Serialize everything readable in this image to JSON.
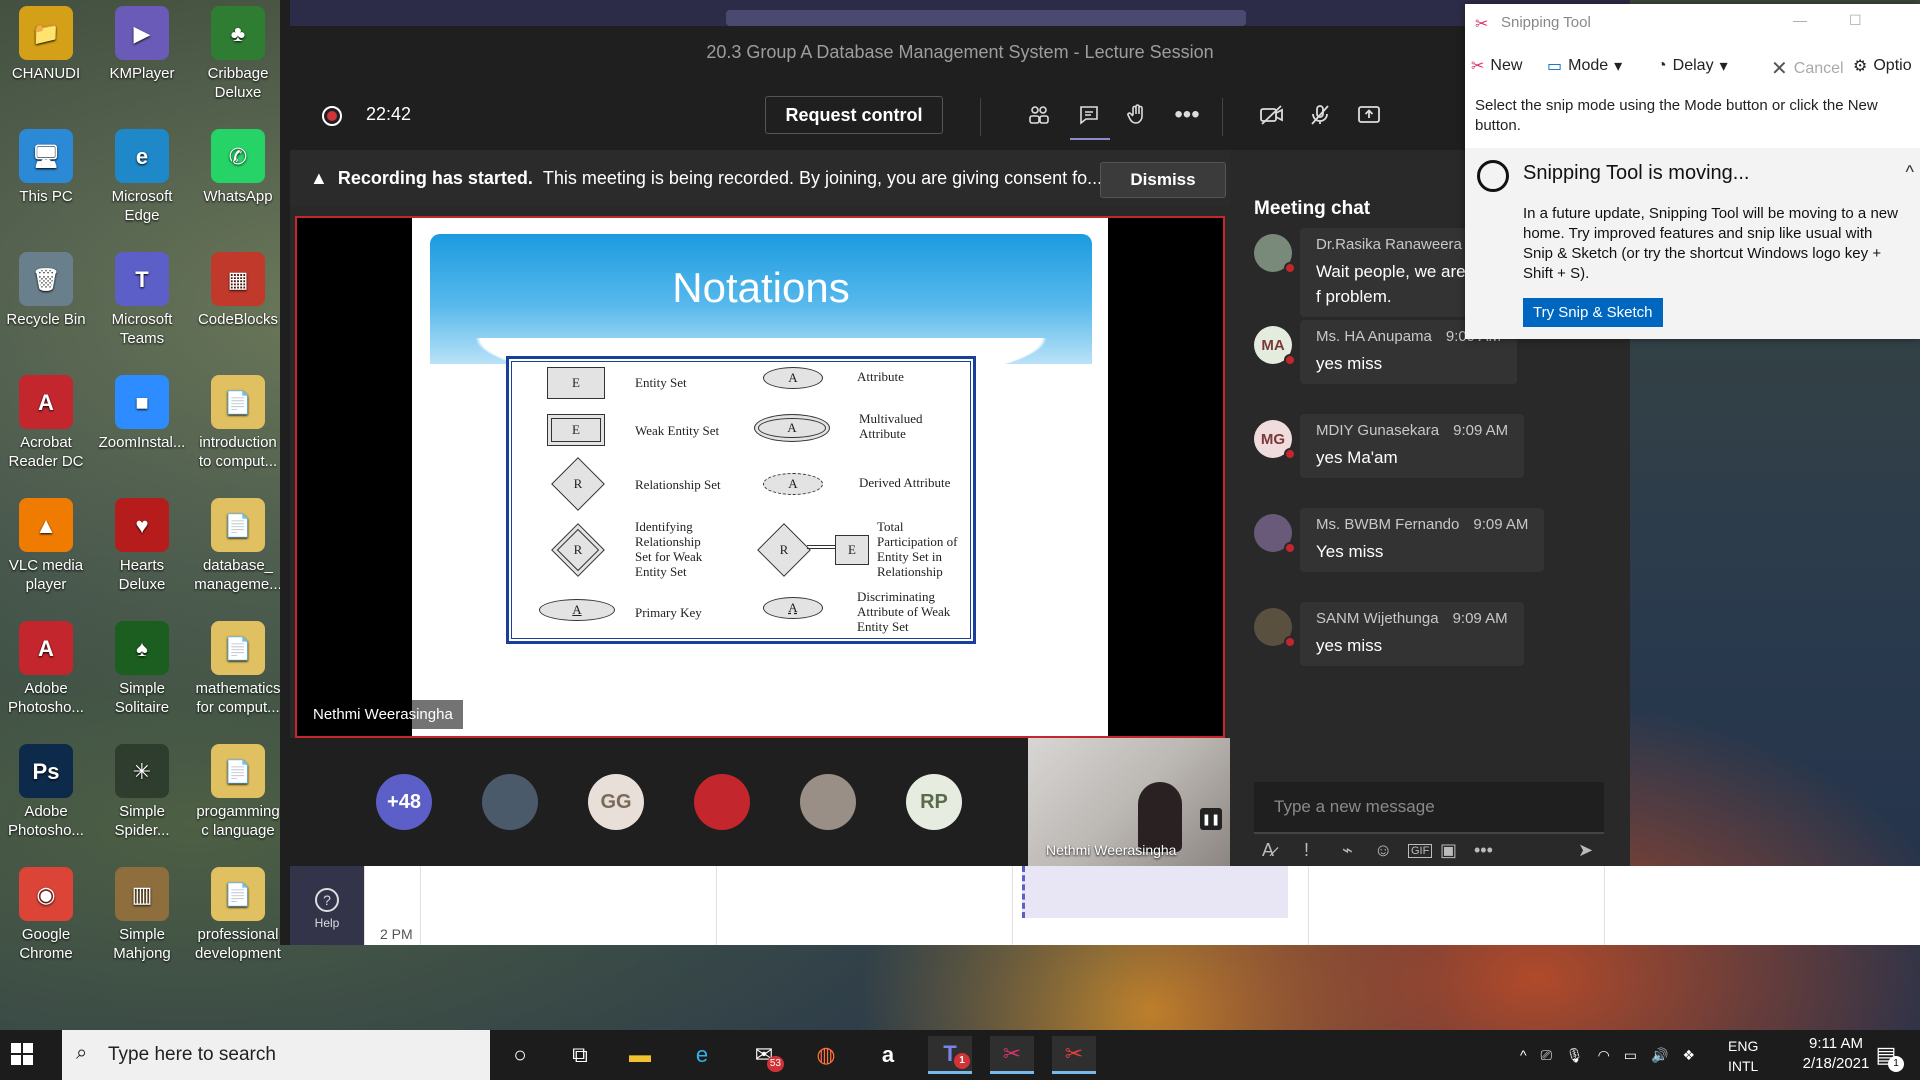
{
  "desktop": {
    "icons": [
      {
        "label": "CHANUDI",
        "glyph": "📁",
        "color": "#d4a017",
        "col": 0,
        "row": 0
      },
      {
        "label": "KMPlayer",
        "glyph": "▶",
        "color": "#6b5bb8",
        "col": 1,
        "row": 0
      },
      {
        "label": "Cribbage Deluxe",
        "glyph": "♣",
        "color": "#2e7d32",
        "col": 2,
        "row": 0
      },
      {
        "label": "This PC",
        "glyph": "🖥",
        "color": "#2b89d6",
        "col": 0,
        "row": 1
      },
      {
        "label": "Microsoft Edge",
        "glyph": "e",
        "color": "#1e88c8",
        "col": 1,
        "row": 1
      },
      {
        "label": "WhatsApp",
        "glyph": "✆",
        "color": "#25d366",
        "col": 2,
        "row": 1
      },
      {
        "label": "Recycle Bin",
        "glyph": "🗑",
        "color": "#6a7f8c",
        "col": 0,
        "row": 2
      },
      {
        "label": "Microsoft Teams",
        "glyph": "T",
        "color": "#5b5fc7",
        "col": 1,
        "row": 2
      },
      {
        "label": "CodeBlocks",
        "glyph": "▦",
        "color": "#c0392b",
        "col": 2,
        "row": 2
      },
      {
        "label": "Acrobat Reader DC",
        "glyph": "A",
        "color": "#c4262e",
        "col": 0,
        "row": 3
      },
      {
        "label": "ZoomInstal...",
        "glyph": "■",
        "color": "#2d8cff",
        "col": 1,
        "row": 3
      },
      {
        "label": "introduction to comput...",
        "glyph": "📄",
        "color": "#e0c060",
        "col": 2,
        "row": 3
      },
      {
        "label": "VLC media player",
        "glyph": "▲",
        "color": "#ef7c00",
        "col": 0,
        "row": 4
      },
      {
        "label": "Hearts Deluxe",
        "glyph": "♥",
        "color": "#b71c1c",
        "col": 1,
        "row": 4
      },
      {
        "label": "database_ manageme...",
        "glyph": "📄",
        "color": "#e0c060",
        "col": 2,
        "row": 4
      },
      {
        "label": "Adobe Photosho...",
        "glyph": "A",
        "color": "#c4262e",
        "col": 0,
        "row": 5
      },
      {
        "label": "Simple Solitaire",
        "glyph": "♠",
        "color": "#1b5e20",
        "col": 1,
        "row": 5
      },
      {
        "label": "mathematics for comput...",
        "glyph": "📄",
        "color": "#e0c060",
        "col": 2,
        "row": 5
      },
      {
        "label": "Adobe Photosho...",
        "glyph": "Ps",
        "color": "#0d2a4a",
        "col": 0,
        "row": 6
      },
      {
        "label": "Simple Spider...",
        "glyph": "✳",
        "color": "#2e3d2e",
        "col": 1,
        "row": 6
      },
      {
        "label": "progamming c language",
        "glyph": "📄",
        "color": "#e0c060",
        "col": 2,
        "row": 6
      },
      {
        "label": "Google Chrome",
        "glyph": "◉",
        "color": "#db4437",
        "col": 0,
        "row": 7
      },
      {
        "label": "Simple Mahjong",
        "glyph": "▥",
        "color": "#8d6e3c",
        "col": 1,
        "row": 7
      },
      {
        "label": "professional development",
        "glyph": "📄",
        "color": "#e0c060",
        "col": 2,
        "row": 7
      }
    ]
  },
  "teams": {
    "window_title": "20.3 Group A Database Management System - Lecture Session",
    "timer": "22:42",
    "request_control": "Request control",
    "banner": {
      "bold": "Recording has started.",
      "text": "This meeting is being recorded. By joining, you are giving consent fo...",
      "dismiss": "Dismiss"
    },
    "slide": {
      "title": "Notations",
      "rows": [
        {
          "shape_left": "E",
          "label_left": "Entity Set",
          "shape_right": "A",
          "label_right": "Attribute"
        },
        {
          "shape_left": "E",
          "label_left": "Weak Entity Set",
          "shape_right": "A",
          "label_right": "Multivalued Attribute"
        },
        {
          "shape_left": "R",
          "label_left": "Relationship Set",
          "shape_right": "A",
          "label_right": "Derived Attribute"
        },
        {
          "shape_left": "R",
          "label_left": "Identifying Relationship Set for Weak Entity Set",
          "shape_right_r": "R",
          "shape_right_e": "E",
          "label_right": "Total Participation of Entity Set in Relationship"
        },
        {
          "shape_left": "A",
          "label_left": "Primary Key",
          "shape_right": "A",
          "label_right": "Discriminating Attribute of Weak Entity Set"
        }
      ]
    },
    "presenter_name": "Nethmi Weerasingha",
    "participants": [
      {
        "label": "+48",
        "bg": "#5b5fc7",
        "fg": "#ffffff"
      },
      {
        "label": "",
        "bg": "#4a5a6a",
        "fg": "#ffffff"
      },
      {
        "label": "GG",
        "bg": "#e8e0d8",
        "fg": "#7a6a5a"
      },
      {
        "label": "",
        "bg": "#c4262e",
        "fg": "#ffffff"
      },
      {
        "label": "",
        "bg": "#9a8f86",
        "fg": "#ffffff"
      },
      {
        "label": "RP",
        "bg": "#e6ece0",
        "fg": "#5a6a4a"
      }
    ],
    "self_view_name": "Nethmi Weerasingha",
    "chat": {
      "title": "Meeting chat",
      "messages": [
        {
          "sender": "Dr.Rasika Ranaweera",
          "time": "9:",
          "text": "Wait people, we are f problem.",
          "initials": "",
          "av_bg": "#7a8a7a"
        },
        {
          "sender": "Ms. HA Anupama",
          "time": "9:09 AM",
          "text": "yes miss",
          "initials": "MA",
          "av_bg": "#e4ece0"
        },
        {
          "sender": "MDIY Gunasekara",
          "time": "9:09 AM",
          "text": "yes Ma'am",
          "initials": "MG",
          "av_bg": "#f0dcdc"
        },
        {
          "sender": "Ms. BWBM Fernando",
          "time": "9:09 AM",
          "text": "Yes miss",
          "initials": "",
          "av_bg": "#6a5a7a"
        },
        {
          "sender": "SANM Wijethunga",
          "time": "9:09 AM",
          "text": "yes miss",
          "initials": "",
          "av_bg": "#5a5040"
        }
      ],
      "compose_placeholder": "Type a new message"
    },
    "calendar": {
      "help": "Help",
      "time_label": "2 PM"
    }
  },
  "snipping_tool": {
    "title": "Snipping Tool",
    "new": "New",
    "mode": "Mode",
    "delay": "Delay",
    "cancel": "Cancel",
    "options": "Optio",
    "hint": "Select the snip mode using the Mode button or click the New button.",
    "card_title": "Snipping Tool is moving...",
    "card_text": "In a future update, Snipping Tool will be moving to a new home. Try improved features and snip like usual with Snip & Sketch (or try the shortcut Windows logo key + Shift + S).",
    "card_button": "Try Snip & Sketch"
  },
  "taskbar": {
    "search_placeholder": "Type here to search",
    "mail_badge": "53",
    "teams_badge": "1",
    "language": "ENG",
    "keyboard": "INTL",
    "time": "9:11 AM",
    "date": "2/18/2021",
    "notif_count": "1"
  }
}
